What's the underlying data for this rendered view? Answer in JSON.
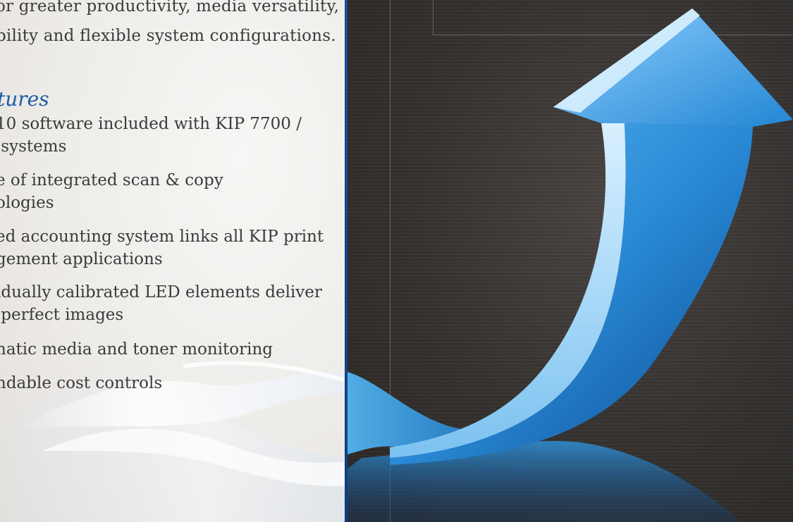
{
  "intro": {
    "line1": "or greater productivity, media versatility,",
    "line2": "bility and flexible system configurations."
  },
  "features_heading": "tures",
  "features": [
    "10 software included with KIP 7700 /\n systems",
    "e of integrated scan & copy\nologies",
    "ed accounting system links all KIP print\ngement applications",
    "idually calibrated LED elements deliver\n perfect images",
    "natic media and toner monitoring",
    "ndable cost controls"
  ],
  "colors": {
    "heading_blue": "#1c5aa6",
    "rule_blue": "#1a4f99",
    "arrow_blue": "#2f8fd8",
    "background_dark": "#35312f"
  },
  "images": {
    "left_decoration": "white-wave-swoosh",
    "right_graphic": "blue-upward-arrow"
  }
}
